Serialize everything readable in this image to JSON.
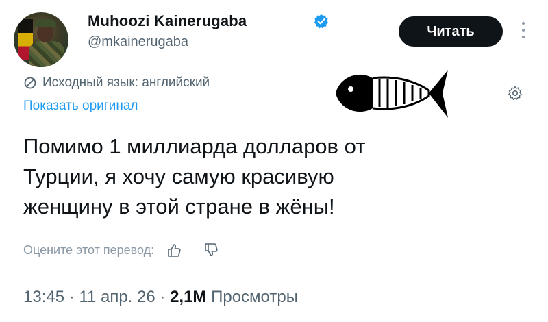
{
  "author": {
    "display_name": "Muhoozi Kainerugaba",
    "handle": "@mkainerugaba",
    "verified": true
  },
  "follow_button": {
    "label": "Читать"
  },
  "translation": {
    "source_note": "Исходный язык: английский",
    "show_original_link": "Показать оригинал"
  },
  "tweet": {
    "lines": [
      "Помимо 1 миллиарда долларов от",
      "Турции, я хочу самую красивую",
      "женщину в этой стране в жёны!"
    ]
  },
  "rating": {
    "label": "Оцените этот перевод:"
  },
  "meta": {
    "time": "13:45",
    "date": "11 апр. 26",
    "views_count": "2,1M",
    "views_label": "Просмотры"
  },
  "colors": {
    "text": "#0f1419",
    "secondary": "#536471",
    "link": "#1d9bf0",
    "button_bg": "#0f1419"
  }
}
